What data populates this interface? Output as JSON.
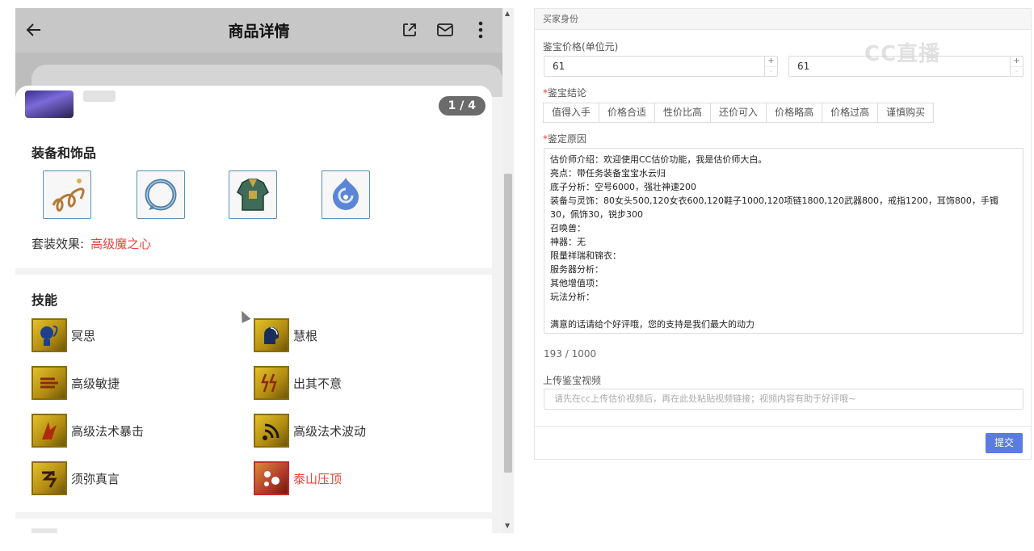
{
  "phone": {
    "header": {
      "title": "商品详情",
      "back_icon": "arrow-left-icon",
      "share_icon": "external-link-icon",
      "mail_icon": "mail-icon",
      "more_icon": "more-vertical-icon"
    },
    "pager": "1 / 4",
    "equipment": {
      "title": "装备和饰品",
      "items": [
        "rope-icon",
        "ring-icon",
        "armor-icon",
        "orb-icon"
      ],
      "set_label": "套装效果:",
      "set_value": "高级魔之心"
    },
    "skills": {
      "title": "技能",
      "items": [
        {
          "label": "冥思",
          "icon": "meditate-icon",
          "highlight": false
        },
        {
          "label": "慧根",
          "icon": "wisdom-icon",
          "highlight": false
        },
        {
          "label": "高级敏捷",
          "icon": "agility-icon",
          "highlight": false
        },
        {
          "label": "出其不意",
          "icon": "surprise-icon",
          "highlight": false
        },
        {
          "label": "高级法术暴击",
          "icon": "spell-crit-icon",
          "highlight": false
        },
        {
          "label": "高级法术波动",
          "icon": "spell-wave-icon",
          "highlight": false
        },
        {
          "label": "须弥真言",
          "icon": "mantra-icon",
          "highlight": false
        },
        {
          "label": "泰山压顶",
          "icon": "mountain-icon",
          "highlight": true
        }
      ]
    }
  },
  "form": {
    "header": "买家身份",
    "price_label": "鉴宝价格(单位元)",
    "price_min": "61",
    "price_max": "61",
    "verdict_label": "鉴宝结论",
    "verdict_options": [
      "值得入手",
      "价格合适",
      "性价比高",
      "还价可入",
      "价格略高",
      "价格过高",
      "谨慎购买"
    ],
    "reason_label": "鉴定原因",
    "reason_text": "估价师介绍：欢迎使用CC估价功能，我是估价师大白。\n亮点：带任务装备宝宝水云归\n底子分析：空号6000，强壮神速200\n装备与灵饰：80女头500,120女衣600,120鞋子1000,120项链1800,120武器800，戒指1200，耳饰800，手镯30，佩饰30，锐步300\n召唤兽：\n神器：无\n限量祥瑞和锦衣：\n服务器分析：\n其他增值项：\n玩法分析：\n\n满意的话请给个好评哦，您的支持是我们最大的动力",
    "counter": "193 / 1000",
    "video_label": "上传鉴宝视频",
    "video_placeholder": "请先在cc上传估价视频后，再在此处粘贴视频链接；视频内容有助于好评哦~",
    "submit": "提交",
    "watermark": "CC直播",
    "accent": "#5b7be0",
    "highlight_color": "#e8443a"
  }
}
